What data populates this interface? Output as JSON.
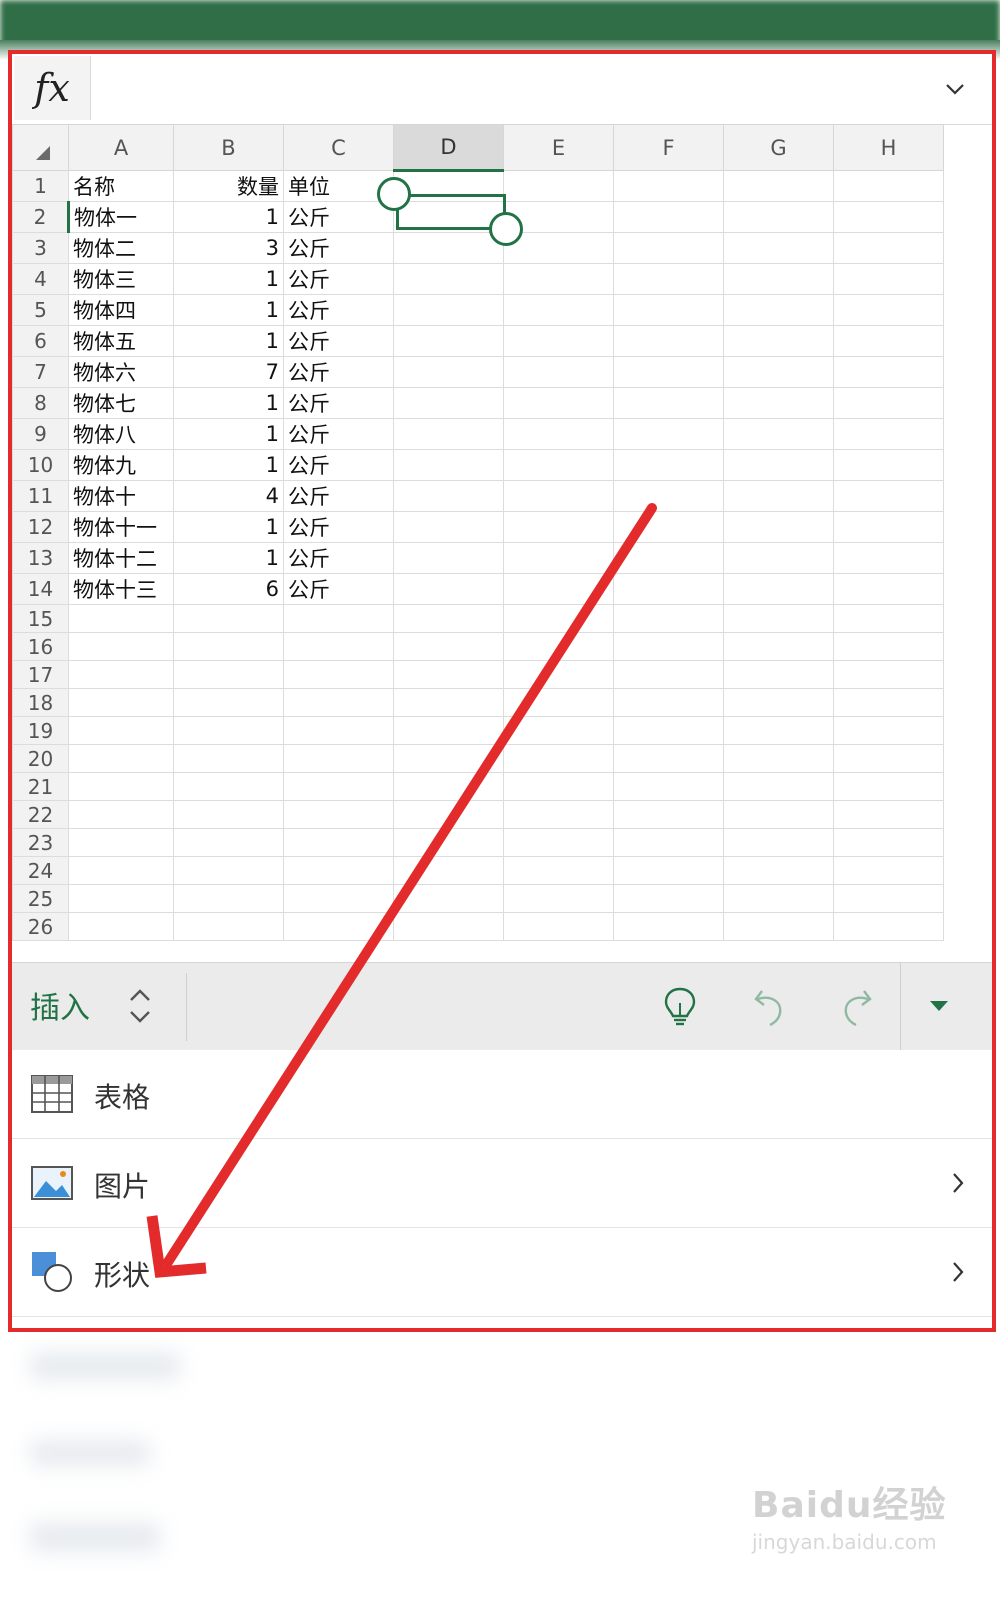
{
  "formula_bar": {
    "fx_label": "fx"
  },
  "columns": [
    "A",
    "B",
    "C",
    "D",
    "E",
    "F",
    "G",
    "H"
  ],
  "selected_column": "D",
  "selected_row": 2,
  "rows": [
    {
      "n": "1",
      "a": "名称",
      "b": "数量",
      "c": "单位"
    },
    {
      "n": "2",
      "a": "物体一",
      "b": "1",
      "c": "公斤"
    },
    {
      "n": "3",
      "a": "物体二",
      "b": "3",
      "c": "公斤"
    },
    {
      "n": "4",
      "a": "物体三",
      "b": "1",
      "c": "公斤"
    },
    {
      "n": "5",
      "a": "物体四",
      "b": "1",
      "c": "公斤"
    },
    {
      "n": "6",
      "a": "物体五",
      "b": "1",
      "c": "公斤"
    },
    {
      "n": "7",
      "a": "物体六",
      "b": "7",
      "c": "公斤"
    },
    {
      "n": "8",
      "a": "物体七",
      "b": "1",
      "c": "公斤"
    },
    {
      "n": "9",
      "a": "物体八",
      "b": "1",
      "c": "公斤"
    },
    {
      "n": "10",
      "a": "物体九",
      "b": "1",
      "c": "公斤"
    },
    {
      "n": "11",
      "a": "物体十",
      "b": "4",
      "c": "公斤"
    },
    {
      "n": "12",
      "a": "物体十一",
      "b": "1",
      "c": "公斤"
    },
    {
      "n": "13",
      "a": "物体十二",
      "b": "1",
      "c": "公斤"
    },
    {
      "n": "14",
      "a": "物体十三",
      "b": "6",
      "c": "公斤"
    },
    {
      "n": "15",
      "a": "",
      "b": "",
      "c": ""
    },
    {
      "n": "16",
      "a": "",
      "b": "",
      "c": ""
    },
    {
      "n": "17",
      "a": "",
      "b": "",
      "c": ""
    },
    {
      "n": "18",
      "a": "",
      "b": "",
      "c": ""
    },
    {
      "n": "19",
      "a": "",
      "b": "",
      "c": ""
    },
    {
      "n": "20",
      "a": "",
      "b": "",
      "c": ""
    },
    {
      "n": "21",
      "a": "",
      "b": "",
      "c": ""
    },
    {
      "n": "22",
      "a": "",
      "b": "",
      "c": ""
    },
    {
      "n": "23",
      "a": "",
      "b": "",
      "c": ""
    },
    {
      "n": "24",
      "a": "",
      "b": "",
      "c": ""
    },
    {
      "n": "25",
      "a": "",
      "b": "",
      "c": ""
    },
    {
      "n": "26",
      "a": "",
      "b": "",
      "c": ""
    }
  ],
  "toolbar": {
    "tab_label": "插入",
    "icons": [
      "lightbulb-icon",
      "undo-icon",
      "redo-icon",
      "dropdown-icon"
    ]
  },
  "menu": {
    "items": [
      {
        "label": "表格",
        "icon": "table-icon",
        "has_submenu": false
      },
      {
        "label": "图片",
        "icon": "picture-icon",
        "has_submenu": true
      },
      {
        "label": "形状",
        "icon": "shapes-icon",
        "has_submenu": true
      }
    ]
  },
  "watermark": {
    "brand": "Baidu经验",
    "url": "jingyan.baidu.com"
  },
  "colors": {
    "accent": "#217346",
    "annotation": "#e32b2b"
  }
}
